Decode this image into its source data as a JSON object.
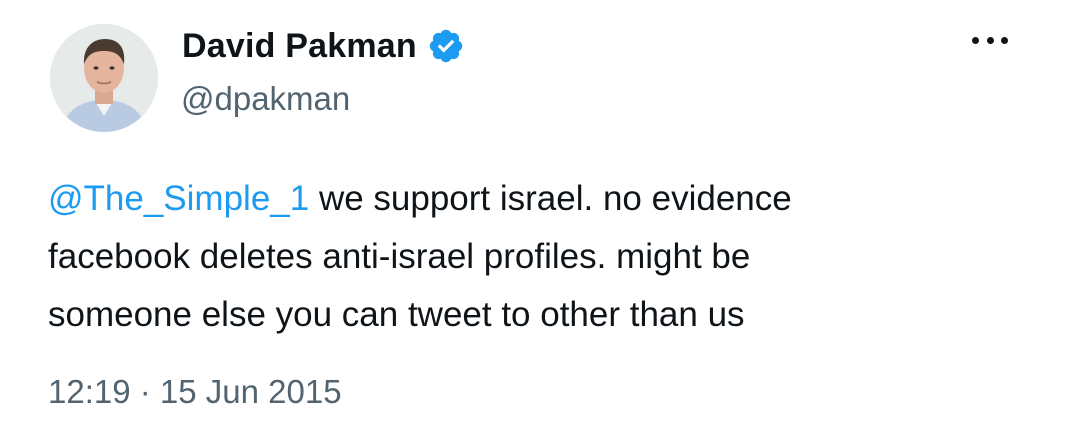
{
  "author": {
    "display_name": "David Pakman",
    "handle": "@dpakman",
    "verified": true,
    "verified_icon": "verified-badge-icon"
  },
  "tweet": {
    "mention": "@The_Simple_1",
    "text_line1": " we support israel. no evidence",
    "text_line2": "facebook deletes anti-israel profiles. might be",
    "text_line3": "someone else you can tweet to other than us"
  },
  "meta": {
    "time": "12:19",
    "separator": " · ",
    "date": "15 Jun 2015"
  },
  "icons": {
    "more": "more-options-icon"
  },
  "colors": {
    "link": "#1d9bf0",
    "secondary_text": "#536471",
    "primary_text": "#0f1419",
    "background": "#ffffff"
  }
}
